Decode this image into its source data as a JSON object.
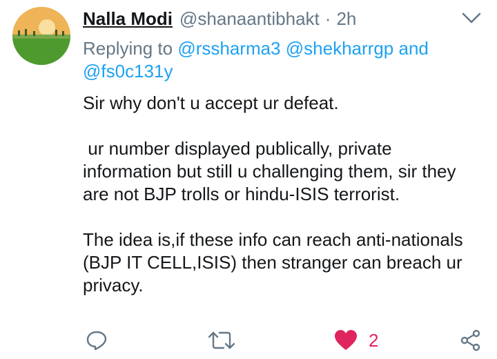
{
  "tweet": {
    "author_name": "Nalla Modi",
    "author_handle": "@shanaantibhakt",
    "separator": "·",
    "time": "2h",
    "replying": {
      "prefix": "Replying to",
      "mentions": [
        "@rssharma3",
        "@shekharrgp",
        "@fs0c131y"
      ],
      "conjunction": "and"
    },
    "paragraphs": [
      "Sir why don't u accept ur defeat.",
      " ur number displayed publically, private information but still u challenging them, sir they are not BJP trolls or hindu-ISIS terrorist.",
      "The idea is,if these info can reach anti-nationals (BJP IT CELL,ISIS) then stranger can breach ur privacy."
    ],
    "like_count": "2"
  },
  "colors": {
    "link": "#1da1f2",
    "secondary_text": "#657786",
    "primary_text": "#14171a",
    "like": "#e0245e"
  },
  "icons": {
    "menu": "chevron-down-icon",
    "reply": "reply-icon",
    "retweet": "retweet-icon",
    "like": "heart-icon",
    "share": "share-icon"
  }
}
